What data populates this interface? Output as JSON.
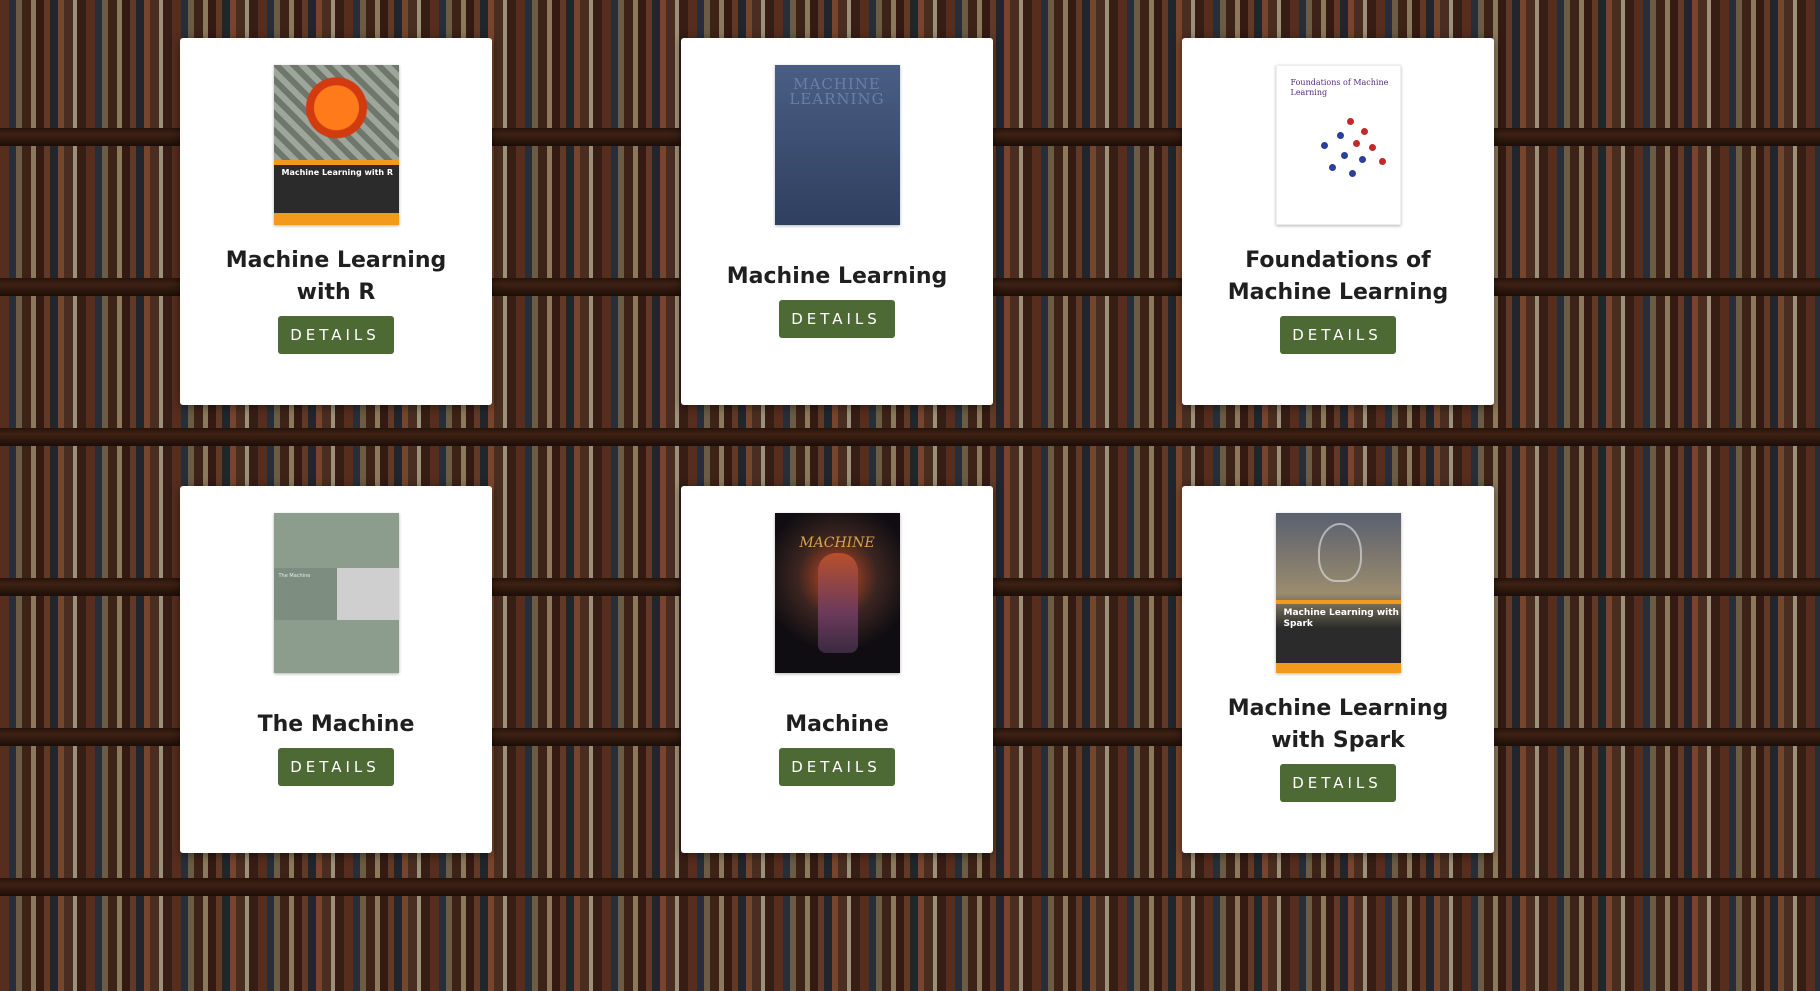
{
  "books": [
    {
      "title": "Machine Learning with R",
      "button_label": "DETAILS",
      "cover_text": "Machine Learning with R"
    },
    {
      "title": "Machine Learning",
      "button_label": "DETAILS",
      "cover_text": "MACHINE LEARNING"
    },
    {
      "title": "Foundations of Machine Learning",
      "button_label": "DETAILS",
      "cover_text": "Foundations of Machine Learning"
    },
    {
      "title": "The Machine",
      "button_label": "DETAILS",
      "cover_text": "The Machine"
    },
    {
      "title": "Machine",
      "button_label": "DETAILS",
      "cover_text": "MACHINE"
    },
    {
      "title": "Machine Learning with Spark",
      "button_label": "DETAILS",
      "cover_text": "Machine Learning with Spark"
    }
  ],
  "colors": {
    "button_bg": "#4e6a34",
    "card_bg": "#ffffff",
    "title_text": "#1f1f1f"
  }
}
